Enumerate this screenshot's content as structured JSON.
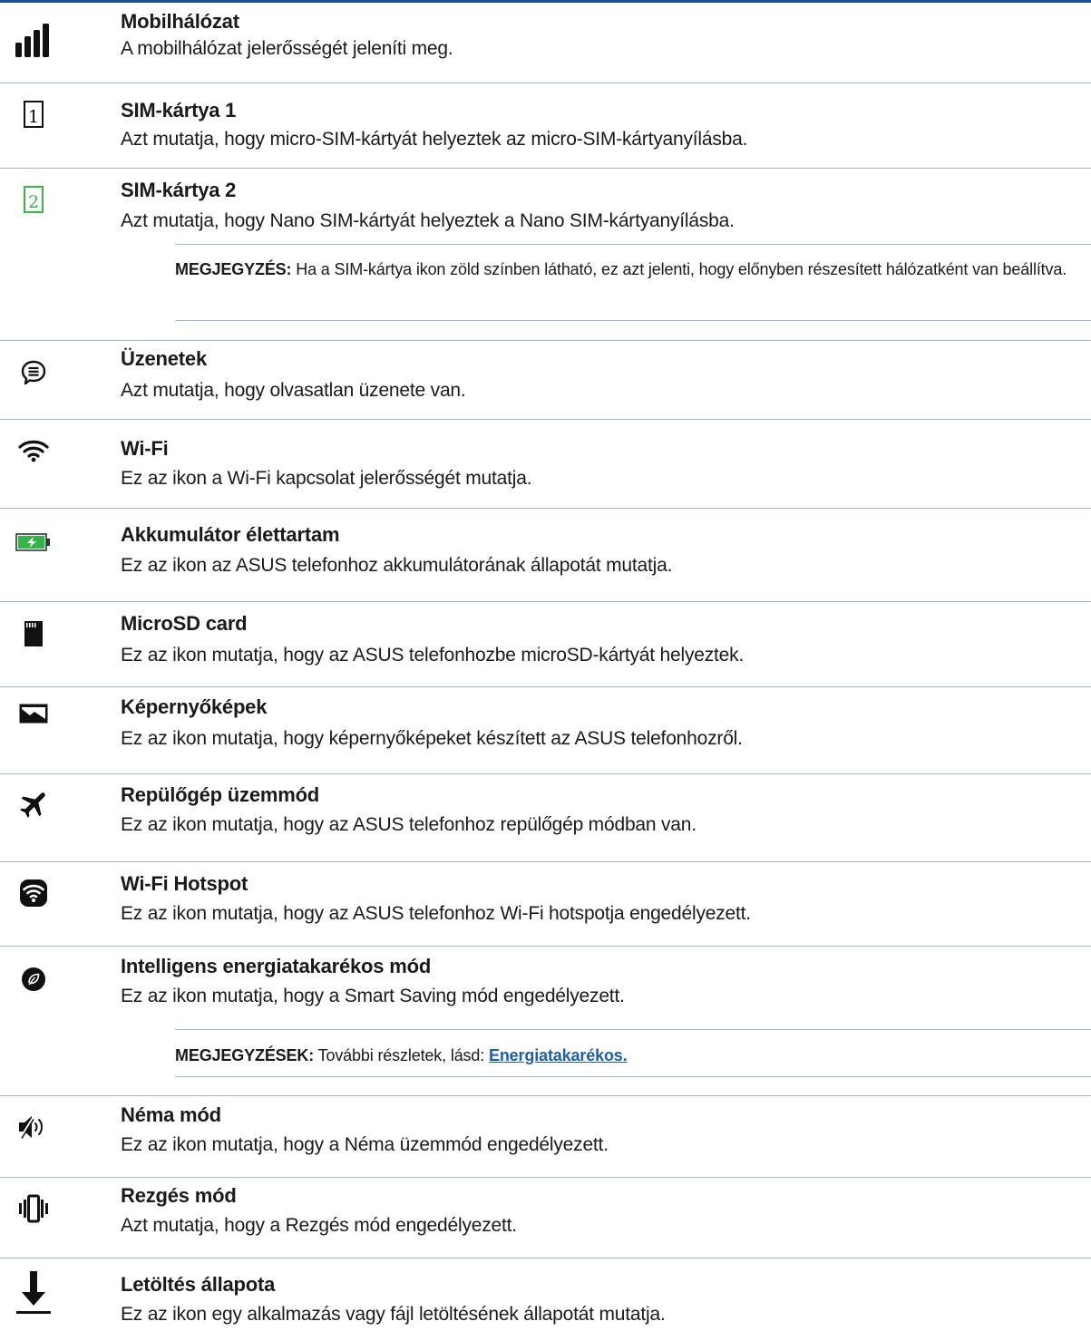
{
  "items": [
    {
      "icon": "signal-bars-icon",
      "title": "Mobilhálózat",
      "desc": "A mobilhálózat jelerősségét jeleníti meg."
    },
    {
      "icon": "sim-card-1-icon",
      "title": "SIM-kártya 1",
      "desc": "Azt mutatja, hogy micro-SIM-kártyát helyeztek az micro-SIM-kártyanyílásba."
    },
    {
      "icon": "sim-card-2-icon",
      "title": "SIM-kártya 2",
      "desc": "Azt mutatja, hogy Nano SIM-kártyát helyeztek a Nano SIM-kártyanyílásba."
    },
    {
      "icon": "message-bubble-icon",
      "title": "Üzenetek",
      "desc": "Azt mutatja, hogy olvasatlan üzenete van."
    },
    {
      "icon": "wifi-icon",
      "title": "Wi-Fi",
      "desc": "Ez az ikon a Wi-Fi kapcsolat jelerősségét mutatja."
    },
    {
      "icon": "battery-charging-icon",
      "title": "Akkumulátor élettartam",
      "desc": "Ez az ikon az ASUS telefonhoz akkumulátorának állapotát mutatja."
    },
    {
      "icon": "microsd-card-icon",
      "title": "MicroSD card",
      "desc": "Ez az ikon mutatja, hogy az ASUS telefonhozbe microSD-kártyát helyeztek."
    },
    {
      "icon": "screenshot-image-icon",
      "title": "Képernyőképek",
      "desc": "Ez az ikon mutatja, hogy képernyőképeket készített az ASUS telefonhozről."
    },
    {
      "icon": "airplane-icon",
      "title": "Repülőgép üzemmód",
      "desc": "Ez az ikon mutatja, hogy az ASUS telefonhoz repülőgép módban van."
    },
    {
      "icon": "wifi-hotspot-icon",
      "title": "Wi-Fi Hotspot",
      "desc": "Ez az ikon mutatja, hogy az ASUS telefonhoz Wi-Fi hotspotja engedélyezett."
    },
    {
      "icon": "smart-saving-leaf-icon",
      "title": "Intelligens energiatakarékos mód",
      "desc": "Ez az ikon mutatja, hogy a Smart Saving mód engedélyezett."
    },
    {
      "icon": "silent-mode-icon",
      "title": "Néma mód",
      "desc": "Ez az ikon mutatja, hogy a Néma üzemmód engedélyezett."
    },
    {
      "icon": "vibrate-mode-icon",
      "title": "Rezgés mód",
      "desc": "Azt mutatja, hogy a Rezgés mód engedélyezett."
    },
    {
      "icon": "download-arrow-icon",
      "title": "Letöltés állapota",
      "desc": "Ez az ikon egy alkalmazás vagy fájl letöltésének állapotát mutatja."
    }
  ],
  "notes": {
    "sim": {
      "label": "MEGJEGYZÉS:",
      "text": " Ha a SIM-kártya ikon zöld színben látható, ez azt jelenti, hogy előnyben részesített hálózatként van beállítva."
    },
    "smart": {
      "label": "MEGJEGYZÉSEK:",
      "text": " További részletek, lásd: ",
      "link": "Energiatakarékos."
    }
  },
  "colors": {
    "rule_top": "#1f4e8c",
    "rule": "#a7b6c9",
    "sim2_green": "#39b54a",
    "battery_green": "#35b34a",
    "link": "#1f5ea8"
  }
}
